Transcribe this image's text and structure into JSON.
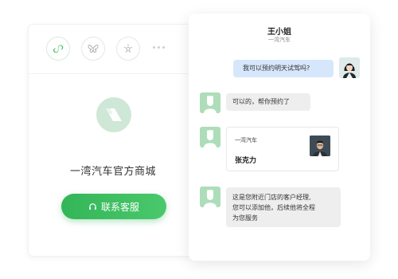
{
  "left_panel": {
    "tabs": [
      {
        "icon": "miniprogram-icon",
        "active": true
      },
      {
        "icon": "butterfly-icon",
        "active": false
      },
      {
        "icon": "sparkle-icon",
        "active": false
      },
      {
        "icon": "more-icon",
        "active": false
      }
    ],
    "store_name": "一湾汽车官方商城",
    "contact_button": "联系客服"
  },
  "chat": {
    "title": "王小姐",
    "subtitle": "一湾汽车",
    "messages": [
      {
        "side": "out",
        "text": "我可以预约明天试驾吗?"
      },
      {
        "side": "in",
        "text": "可以的，帮你预约了"
      },
      {
        "side": "in",
        "type": "card",
        "company": "一湾汽车",
        "person": "张克力"
      },
      {
        "side": "in",
        "lines": [
          "这是您附近门店的客户经理,",
          "您可以添加他，后续他将全程",
          "为您服务"
        ]
      }
    ]
  },
  "colors": {
    "accent_green": "#3dbb5f",
    "outgoing_bubble": "#d7e7fb",
    "incoming_bubble": "#eeeeee",
    "avatar_green": "#aeddb9"
  }
}
